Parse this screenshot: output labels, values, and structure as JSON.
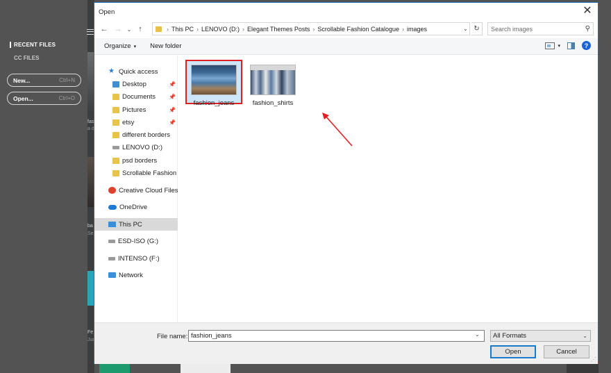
{
  "background_app": {
    "nav_recent": "RECENT FILES",
    "nav_cc": "CC FILES",
    "new_button": "New...",
    "new_shortcut": "Ctrl+N",
    "open_button": "Open...",
    "open_shortcut": "Ctrl+O",
    "fragments": [
      "fas",
      "a d",
      "ba",
      "Sep",
      "Fe",
      "Jun"
    ]
  },
  "dialog": {
    "title": "Open",
    "address": {
      "crumbs": [
        "This PC",
        "LENOVO (D:)",
        "Elegant Themes Posts",
        "Scrollable Fashion Catalogue",
        "images"
      ]
    },
    "search_placeholder": "Search images",
    "toolbar": {
      "organize": "Organize",
      "new_folder": "New folder",
      "help": "?"
    },
    "sidebar": [
      {
        "label": "Quick access",
        "icon": "star-icon",
        "pinned": false
      },
      {
        "label": "Desktop",
        "icon": "folder-blue-icon",
        "pinned": true
      },
      {
        "label": "Documents",
        "icon": "folder-icon",
        "pinned": true
      },
      {
        "label": "Pictures",
        "icon": "folder-icon",
        "pinned": true
      },
      {
        "label": "etsy",
        "icon": "folder-icon",
        "pinned": true
      },
      {
        "label": "different borders",
        "icon": "folder-icon",
        "pinned": false
      },
      {
        "label": "LENOVO (D:)",
        "icon": "drive-icon",
        "pinned": false
      },
      {
        "label": "psd borders",
        "icon": "folder-icon",
        "pinned": false
      },
      {
        "label": "Scrollable Fashion C",
        "icon": "folder-icon",
        "pinned": false
      },
      {
        "label": "Creative Cloud Files",
        "icon": "creative-cloud-icon",
        "pinned": false
      },
      {
        "label": "OneDrive",
        "icon": "cloud-icon",
        "pinned": false
      },
      {
        "label": "This PC",
        "icon": "computer-icon",
        "pinned": false,
        "selected": true
      },
      {
        "label": "ESD-ISO (G:)",
        "icon": "drive-icon",
        "pinned": false
      },
      {
        "label": "INTENSO (F:)",
        "icon": "drive-icon",
        "pinned": false
      },
      {
        "label": "Network",
        "icon": "network-icon",
        "pinned": false
      }
    ],
    "files": [
      {
        "name": "fashion_jeans",
        "selected": true
      },
      {
        "name": "fashion_shirts",
        "selected": false
      }
    ],
    "file_name_label": "File name:",
    "file_name_value": "fashion_jeans",
    "format_value": "All Formats",
    "open_button": "Open",
    "cancel_button": "Cancel"
  },
  "colors": {
    "selection_highlight": "#e02020",
    "arrow": "#e02020",
    "primary_border": "#1979ca"
  }
}
